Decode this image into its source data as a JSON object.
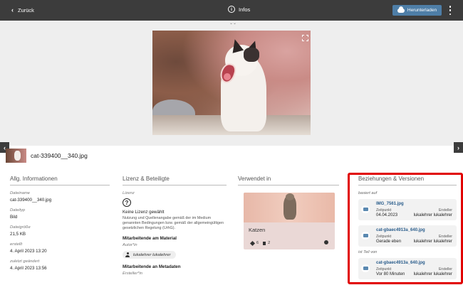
{
  "topbar": {
    "back_label": "Zurück",
    "info_label": "Infos",
    "download_label": "Herunterladen"
  },
  "file": {
    "name": "cat-339400__340.jpg"
  },
  "general": {
    "title": "Allg. Informationen",
    "fields": [
      {
        "label": "Dateiname",
        "value": "cat-339400__340.jpg"
      },
      {
        "label": "Dateityp",
        "value": "Bild"
      },
      {
        "label": "Dateigröße",
        "value": "21,5 KB"
      },
      {
        "label": "erstellt",
        "value": "4. April 2023 13:20"
      },
      {
        "label": "zuletzt geändert",
        "value": "4. April 2023 13:56"
      }
    ]
  },
  "license": {
    "title": "Lizenz & Beteiligte",
    "label": "Lizenz",
    "icon_text": "?",
    "name": "Keine Lizenz gewählt",
    "description": "Nutzung und Quellenangabe gemäß der im Medium genannten Bedingungen bzw. gemäß der allgemeingültigen gesetzlichen Regelung (UrhG).",
    "material_heading": "Mitarbeitende am Material",
    "material_role": "Autor*in",
    "material_person": "lukalehrer lukalehrer",
    "metadata_heading": "Mitarbeitende an Metadaten",
    "metadata_role": "Ersteller*in"
  },
  "used_in": {
    "title": "Verwendet in",
    "collection": {
      "title": "Katzen",
      "count_materials": "6",
      "count_docs": "2"
    }
  },
  "relations": {
    "title": "Beziehungen & Versionen",
    "based_on_label": "basiert auf",
    "part_of_label": "ist Teil von",
    "items": [
      {
        "name": "IMG_7561.jpg",
        "key1": "Zeitpunkt",
        "value1": "04.04.2023",
        "key2": "Ersteller",
        "value2": "lukalehrer lukalehrer"
      },
      {
        "name": "cat-gbaec4913a_640.jpg",
        "key1": "Zeitpunkt",
        "value1": "Gerade eben",
        "key2": "Ersteller",
        "value2": "lukalehrer lukalehrer"
      },
      {
        "name": "cat-gbaec4913a_640.jpg",
        "key1": "Zeitpunkt",
        "value1": "Vor 80 Minuten",
        "key2": "Ersteller",
        "value2": "lukalehrer lukalehrer"
      }
    ]
  },
  "colors": {
    "topbar": "#3c3c3c",
    "accent": "#4e7ea7",
    "highlight": "#e10000",
    "link": "#2a5d8c"
  }
}
